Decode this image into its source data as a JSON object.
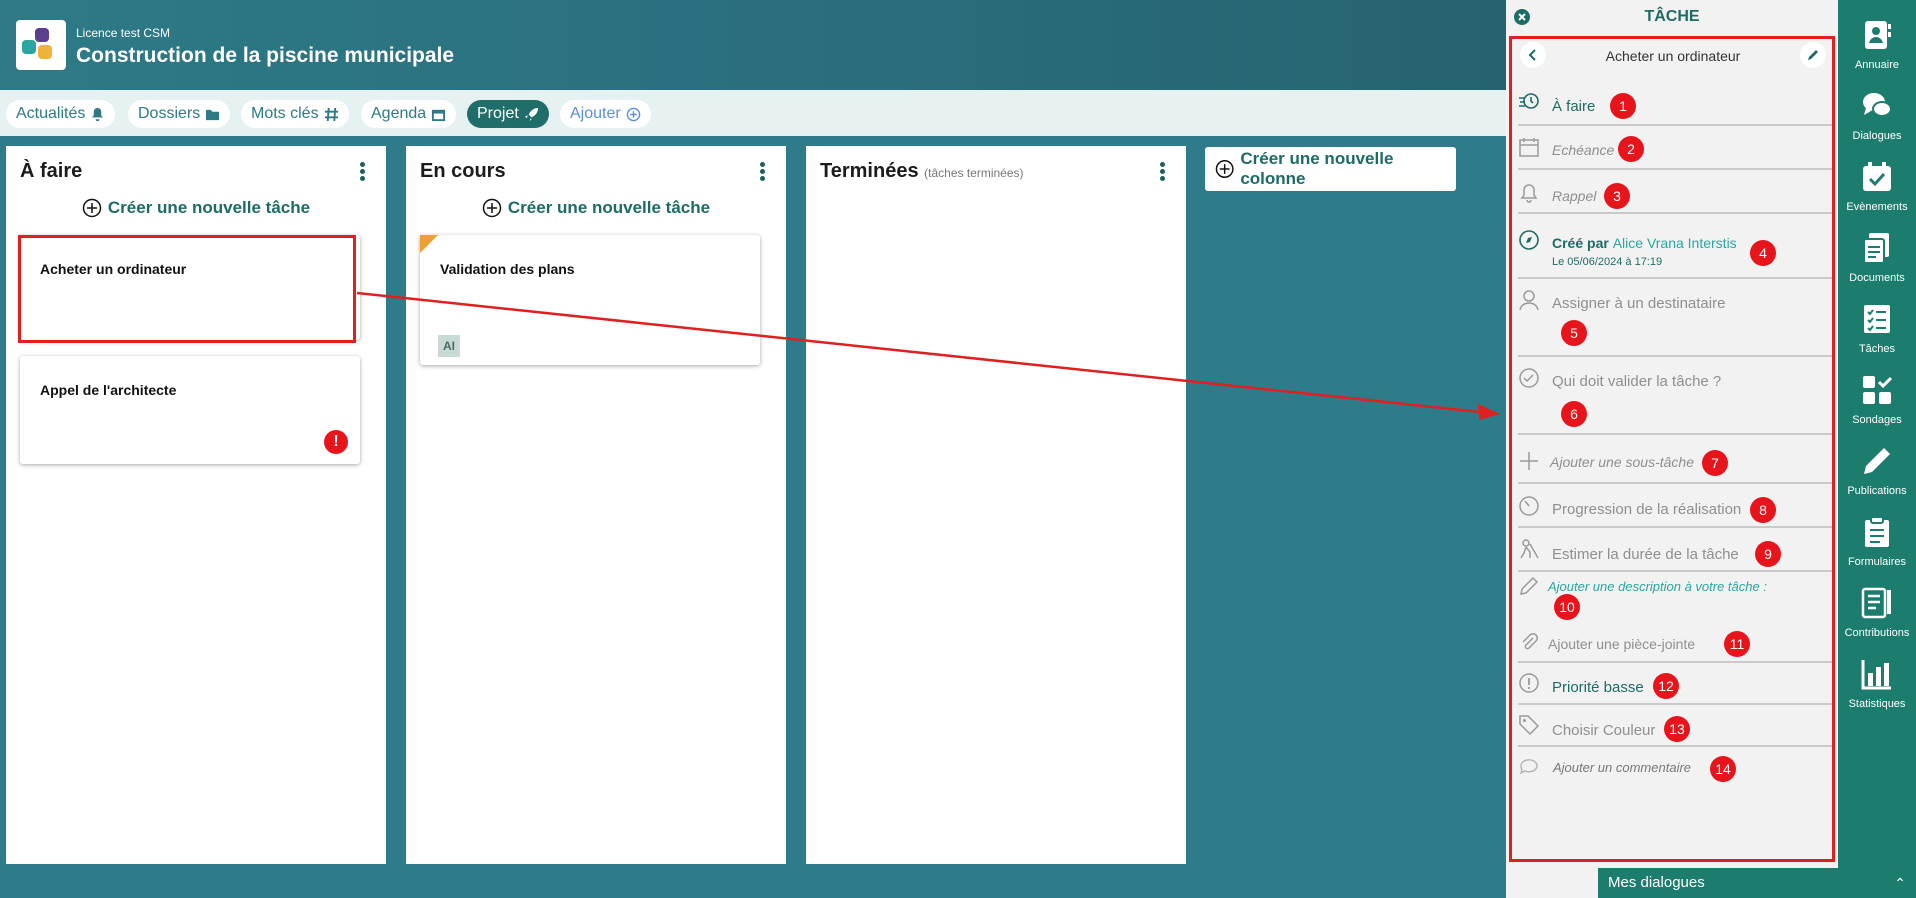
{
  "header": {
    "license": "Licence test CSM",
    "project": "Construction de la piscine municipale"
  },
  "tabs": [
    {
      "label": "Actualités",
      "icon": "bell-icon"
    },
    {
      "label": "Dossiers",
      "icon": "folder-icon"
    },
    {
      "label": "Mots clés",
      "icon": "hash-icon"
    },
    {
      "label": "Agenda",
      "icon": "calendar-icon"
    },
    {
      "label": "Projet",
      "icon": "rocket-icon",
      "active": true
    },
    {
      "label": "Ajouter",
      "icon": "plus-circle-icon"
    }
  ],
  "columns": [
    {
      "title": "À faire",
      "new_task": "Créer une nouvelle tâche",
      "cards": [
        {
          "title": "Acheter un ordinateur"
        },
        {
          "title": "Appel de l'architecte",
          "flag": "!"
        }
      ]
    },
    {
      "title": "En cours",
      "new_task": "Créer une nouvelle tâche",
      "cards": [
        {
          "title": "Validation des plans",
          "tag": "AI"
        }
      ]
    },
    {
      "title": "Terminées",
      "subtitle": "(tâches terminées)"
    }
  ],
  "new_column": "Créer une nouvelle colonne",
  "panel": {
    "title": "TÂCHE",
    "task_title": "Acheter un ordinateur",
    "rows": [
      {
        "label": "À faire",
        "badge": "1",
        "icon": "status-icon"
      },
      {
        "label": "Echéance",
        "badge": "2",
        "icon": "calendar-icon"
      },
      {
        "label": "Rappel",
        "badge": "3",
        "icon": "bell-icon"
      },
      {
        "label": "Créé par",
        "author": "Alice Vrana Interstis",
        "date": "Le 05/06/2024 à 17:19",
        "badge": "4",
        "icon": "compass-icon"
      },
      {
        "label": "Assigner à un destinataire",
        "badge": "5",
        "icon": "user-icon"
      },
      {
        "label": "Qui doit valider la tâche ?",
        "badge": "6",
        "icon": "check-circle-icon"
      },
      {
        "label": "Ajouter une sous-tâche",
        "badge": "7",
        "icon": "plus-icon"
      },
      {
        "label": "Progression de la réalisation",
        "badge": "8",
        "icon": "gauge-icon"
      },
      {
        "label": "Estimer la durée de la tâche",
        "badge": "9",
        "icon": "worker-icon"
      },
      {
        "label": "Ajouter une description à votre tâche :",
        "badge": "10",
        "icon": "pencil-icon"
      },
      {
        "label": "Ajouter une pièce-jointe",
        "badge": "11",
        "icon": "paperclip-icon"
      },
      {
        "label": "Priorité basse",
        "badge": "12",
        "icon": "exclamation-circle-icon"
      },
      {
        "label": "Choisir Couleur",
        "badge": "13",
        "icon": "tag-icon"
      },
      {
        "label": "Ajouter un commentaire",
        "badge": "14",
        "icon": "comment-icon"
      }
    ]
  },
  "nav": [
    {
      "label": "Annuaire",
      "icon": "contacts-icon"
    },
    {
      "label": "Dialogues",
      "icon": "chat-icon"
    },
    {
      "label": "Evènements",
      "icon": "calendar-check-icon"
    },
    {
      "label": "Documents",
      "icon": "documents-icon"
    },
    {
      "label": "Tâches",
      "icon": "tasks-icon"
    },
    {
      "label": "Sondages",
      "icon": "polls-icon"
    },
    {
      "label": "Publications",
      "icon": "pencil-icon"
    },
    {
      "label": "Formulaires",
      "icon": "clipboard-icon"
    },
    {
      "label": "Contributions",
      "icon": "contributions-icon"
    },
    {
      "label": "Statistiques",
      "icon": "bar-chart-icon"
    }
  ],
  "footer": {
    "dialogs": "Mes dialogues"
  },
  "colors": {
    "teal": "#2d7a86",
    "accent": "#1e6b66",
    "nav": "#1c7d6f",
    "badge": "#e8141b",
    "annotation": "#e02020"
  }
}
